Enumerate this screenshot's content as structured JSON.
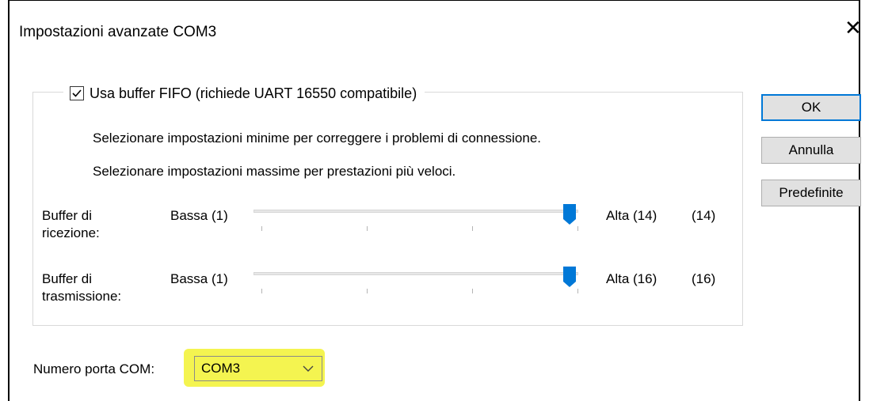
{
  "window": {
    "title": "Impostazioni avanzate COM3",
    "close_glyph": "✕"
  },
  "fifo": {
    "checkbox_label": "Usa buffer FIFO (richiede UART 16550 compatibile)",
    "checked": true,
    "info_min": "Selezionare impostazioni minime per correggere i problemi di connessione.",
    "info_max": "Selezionare impostazioni massime per prestazioni più veloci."
  },
  "receive": {
    "label_line1": "Buffer di",
    "label_line2": "ricezione:",
    "low_label": "Bassa (1)",
    "high_label": "Alta (14)",
    "current": "(14)",
    "min": 1,
    "max": 14,
    "value": 14
  },
  "transmit": {
    "label_line1": "Buffer di",
    "label_line2": "trasmissione:",
    "low_label": "Bassa (1)",
    "high_label": "Alta (16)",
    "current": "(16)",
    "min": 1,
    "max": 16,
    "value": 16
  },
  "buttons": {
    "ok": "OK",
    "cancel": "Annulla",
    "defaults": "Predefinite"
  },
  "com_port": {
    "label": "Numero porta COM:",
    "value": "COM3"
  },
  "colors": {
    "accent": "#0078d7",
    "highlight": "#f4f450"
  }
}
